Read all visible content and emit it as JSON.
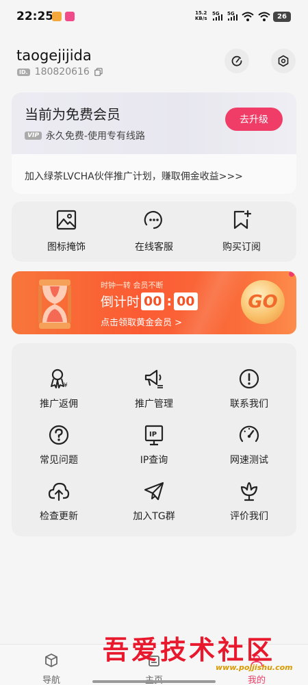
{
  "status_bar": {
    "time": "22:25",
    "net_speed_value": "15.2",
    "net_speed_unit": "KB/s",
    "signal1": "5G",
    "signal2": "5G",
    "battery": "26"
  },
  "header": {
    "username": "taogejijida",
    "id_badge": "ID.",
    "id_number": "180820616"
  },
  "membership": {
    "title": "当前为免费会员",
    "vip_badge": "VIP",
    "subtitle": "永久免费-使用专有线路",
    "upgrade_label": "去升级",
    "partner_text": "加入绿茶LVCHA伙伴推广计划，赚取佣金收益>>>"
  },
  "quick_actions": [
    {
      "label": "图标掩饰",
      "icon": "image-icon"
    },
    {
      "label": "在线客服",
      "icon": "customer-service-icon"
    },
    {
      "label": "购买订阅",
      "icon": "bookmark-add-icon"
    }
  ],
  "promo": {
    "top_text": "时钟一转 会员不断",
    "countdown_label": "倒计时",
    "minutes": "00",
    "seconds": "00",
    "bottom_text": "点击领取黄金会员 >",
    "go_label": "GO"
  },
  "menu": [
    {
      "label": "推广返佣",
      "icon": "commission-icon"
    },
    {
      "label": "推广管理",
      "icon": "megaphone-icon"
    },
    {
      "label": "联系我们",
      "icon": "alert-circle-icon"
    },
    {
      "label": "常见问题",
      "icon": "question-icon"
    },
    {
      "label": "IP查询",
      "icon": "ip-icon"
    },
    {
      "label": "网速测试",
      "icon": "speedometer-icon"
    },
    {
      "label": "检查更新",
      "icon": "cloud-upload-icon"
    },
    {
      "label": "加入TG群",
      "icon": "telegram-icon"
    },
    {
      "label": "评价我们",
      "icon": "flower-icon"
    }
  ],
  "bottom_nav": [
    {
      "label": "导航",
      "icon": "box-icon"
    },
    {
      "label": "主页",
      "icon": "home-icon"
    },
    {
      "label": "我的",
      "icon": "profile-icon",
      "active": true
    }
  ],
  "watermark": {
    "title": "吾爱技术社区",
    "url": "www.pojjishu.com"
  },
  "colors": {
    "accent": "#f03d68",
    "promo": "#fb5b33",
    "card": "#eeeeee"
  }
}
